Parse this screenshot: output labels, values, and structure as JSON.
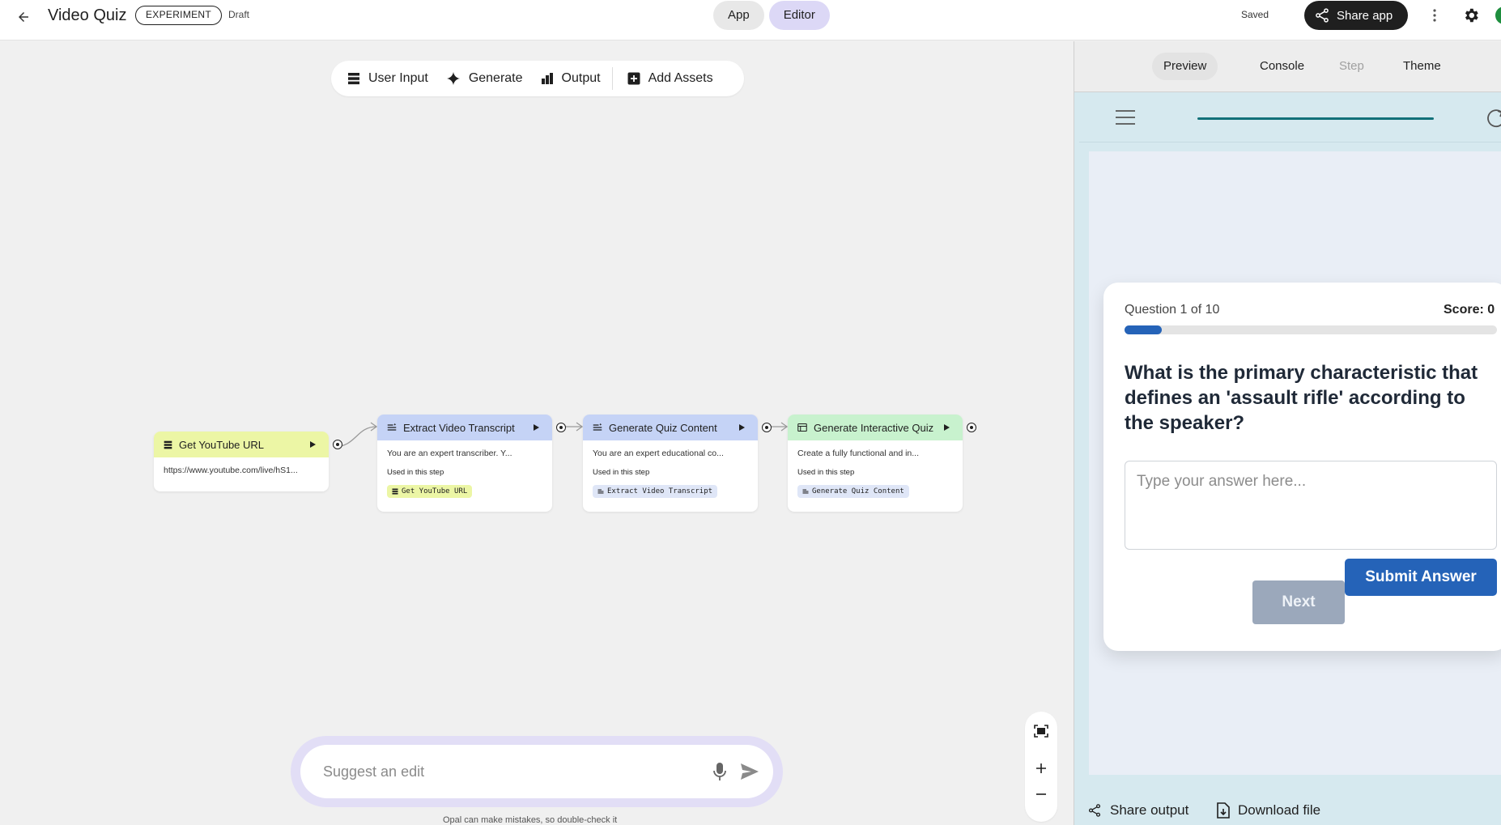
{
  "header": {
    "title": "Video Quiz",
    "badge": "EXPERIMENT",
    "status": "Draft",
    "modes": [
      {
        "label": "App",
        "active": false
      },
      {
        "label": "Editor",
        "active": true
      }
    ],
    "saved": "Saved",
    "share_label": "Share app",
    "avatar_color": "#1e8e3e"
  },
  "toolbar": {
    "user_input": "User Input",
    "generate": "Generate",
    "output": "Output",
    "add_assets": "Add Assets"
  },
  "nodes": [
    {
      "title": "Get YouTube URL",
      "kind": "input",
      "header_color": "#ecf6a5",
      "body": "https://www.youtube.com/live/hS1..."
    },
    {
      "title": "Extract Video Transcript",
      "kind": "generate",
      "header_color": "#c5d3f6",
      "body": "You are an expert transcriber. Y...",
      "used_label": "Used in this step",
      "chip": "Get YouTube URL",
      "chip_color": "#ecf6a5"
    },
    {
      "title": "Generate Quiz Content",
      "kind": "generate",
      "header_color": "#c5d3f6",
      "body": "You are an expert educational co...",
      "used_label": "Used in this step",
      "chip": "Extract Video Transcript",
      "chip_color": "#dfe6f7"
    },
    {
      "title": "Generate Interactive Quiz",
      "kind": "output",
      "header_color": "#c8f2ce",
      "body": "Create a fully functional and in...",
      "used_label": "Used in this step",
      "chip": "Generate Quiz Content",
      "chip_color": "#dfe6f7"
    }
  ],
  "suggest": {
    "placeholder": "Suggest an edit",
    "disclaimer": "Opal can make mistakes, so double-check it"
  },
  "right_panel": {
    "tabs": [
      {
        "label": "Preview",
        "state": "active"
      },
      {
        "label": "Console",
        "state": "normal"
      },
      {
        "label": "Step",
        "state": "disabled"
      },
      {
        "label": "Theme",
        "state": "normal"
      }
    ],
    "quiz": {
      "counter": "Question 1 of 10",
      "score": "Score: 0",
      "progress_fraction": 0.1,
      "question": "What is the primary characteristic that defines an 'assault rifle' according to the speaker?",
      "answer_placeholder": "Type your answer here...",
      "submit_label": "Submit Answer",
      "next_label": "Next",
      "accent_color": "#2563b8"
    },
    "footer": {
      "share_output": "Share output",
      "download_file": "Download file"
    }
  }
}
